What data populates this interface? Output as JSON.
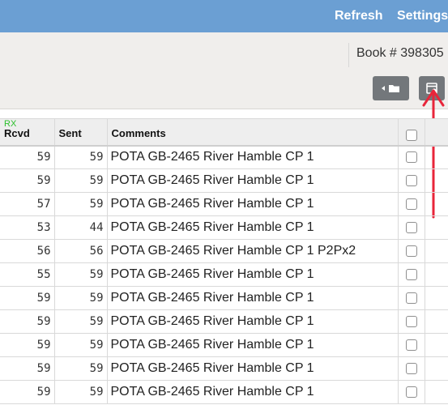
{
  "nav": {
    "refresh": "Refresh",
    "settings": "Settings"
  },
  "toolbar": {
    "book_label": "Book # 398305",
    "folder_button_icon": "folder-back-icon",
    "export_button_icon": "export-icon"
  },
  "annotation": {
    "arrow_color": "#e8253a",
    "arrow_icon": "red-arrow-up-icon"
  },
  "table": {
    "rx_label": "RX",
    "headers": {
      "rcvd": "Rcvd",
      "sent": "Sent",
      "comments": "Comments"
    },
    "rows": [
      {
        "rcvd": "59",
        "sent": "59",
        "comment": "POTA GB-2465 River Hamble CP 1"
      },
      {
        "rcvd": "59",
        "sent": "59",
        "comment": "POTA GB-2465 River Hamble CP 1"
      },
      {
        "rcvd": "57",
        "sent": "59",
        "comment": "POTA GB-2465 River Hamble CP 1"
      },
      {
        "rcvd": "53",
        "sent": "44",
        "comment": "POTA GB-2465 River Hamble CP 1"
      },
      {
        "rcvd": "56",
        "sent": "56",
        "comment": "POTA GB-2465 River Hamble CP 1 P2Px2"
      },
      {
        "rcvd": "55",
        "sent": "59",
        "comment": "POTA GB-2465 River Hamble CP 1"
      },
      {
        "rcvd": "59",
        "sent": "59",
        "comment": "POTA GB-2465 River Hamble CP 1"
      },
      {
        "rcvd": "59",
        "sent": "59",
        "comment": "POTA GB-2465 River Hamble CP 1"
      },
      {
        "rcvd": "59",
        "sent": "59",
        "comment": "POTA GB-2465 River Hamble CP 1"
      },
      {
        "rcvd": "59",
        "sent": "59",
        "comment": "POTA GB-2465 River Hamble CP 1"
      },
      {
        "rcvd": "59",
        "sent": "59",
        "comment": "POTA GB-2465 River Hamble CP 1"
      }
    ]
  }
}
